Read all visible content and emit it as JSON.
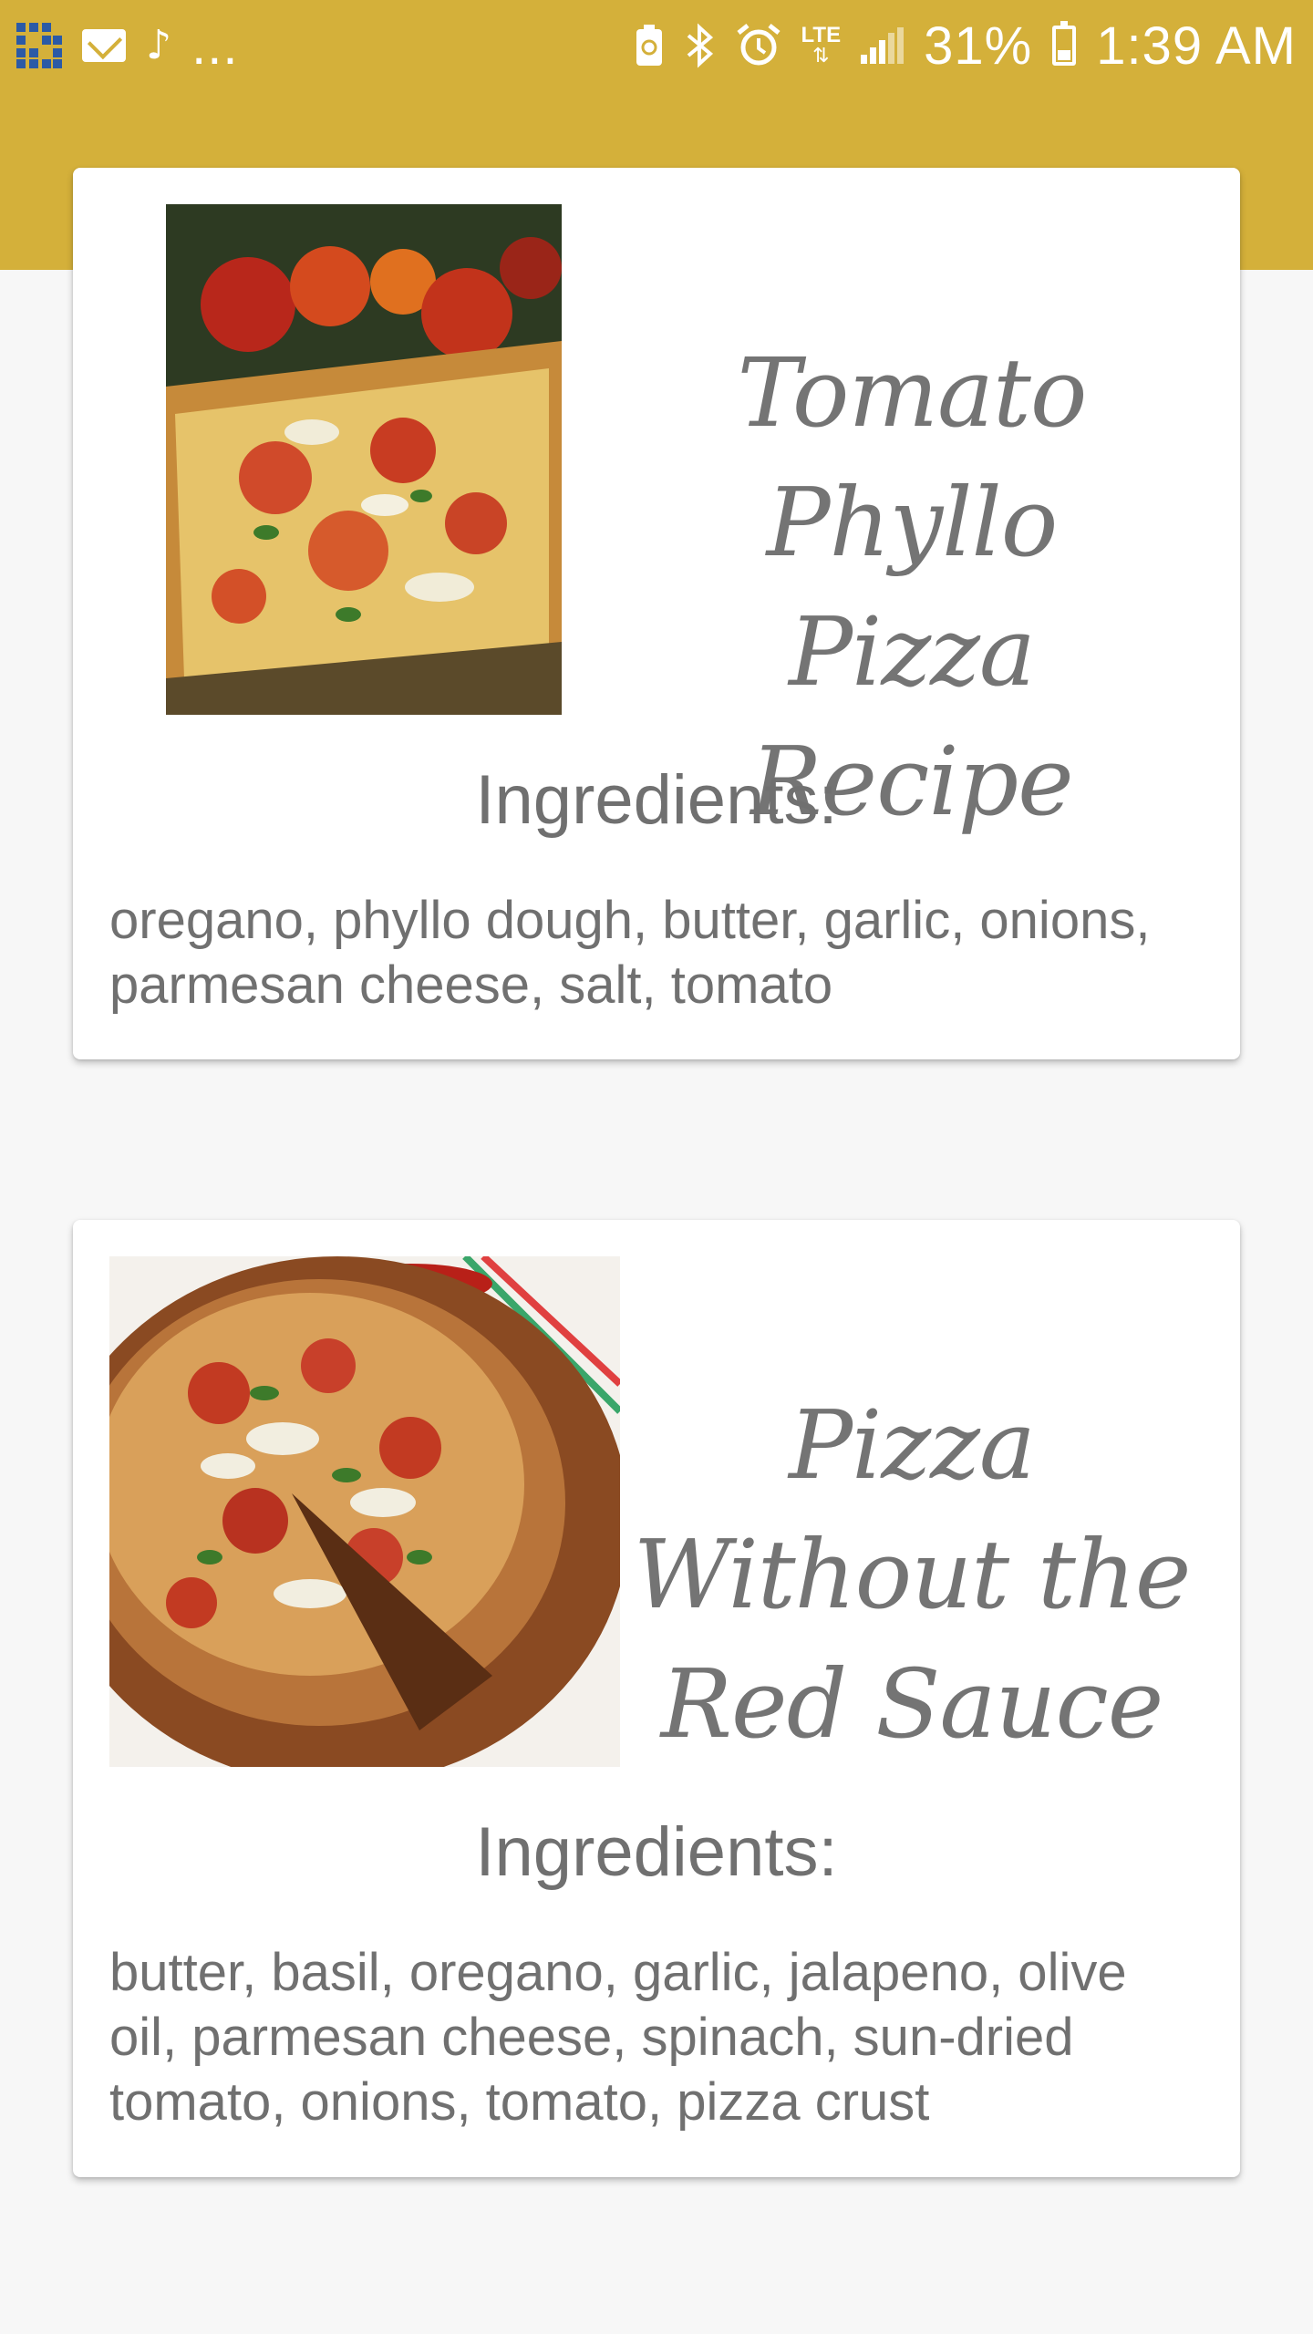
{
  "status_bar": {
    "battery_percent": "31%",
    "time": "1:39 AM",
    "overflow": "...",
    "left_icons": [
      "app-icon",
      "gmail-icon",
      "music-note-icon"
    ],
    "right_icons": [
      "battery-saver-icon",
      "bluetooth-icon",
      "alarm-icon",
      "lte-icon",
      "signal-icon",
      "battery-charging-icon"
    ],
    "lte_label": "LTE",
    "background_color": "#d4b03a"
  },
  "recipes": [
    {
      "title": "Tomato Phyllo Pizza Recipe",
      "ingredients_heading": "Ingredients:",
      "ingredients": "oregano, phyllo dough, butter, garlic, onions, parmesan cheese, salt, tomato"
    },
    {
      "title": "Pizza Without the Red Sauce",
      "ingredients_heading": "Ingredients:",
      "ingredients": "butter, basil, oregano, garlic, jalapeno, olive oil, parmesan cheese, spinach, sun-dried tomato, onions, tomato, pizza crust"
    }
  ],
  "colors": {
    "header": "#d4b03a",
    "text": "#707070",
    "background": "#f7f7f7"
  }
}
